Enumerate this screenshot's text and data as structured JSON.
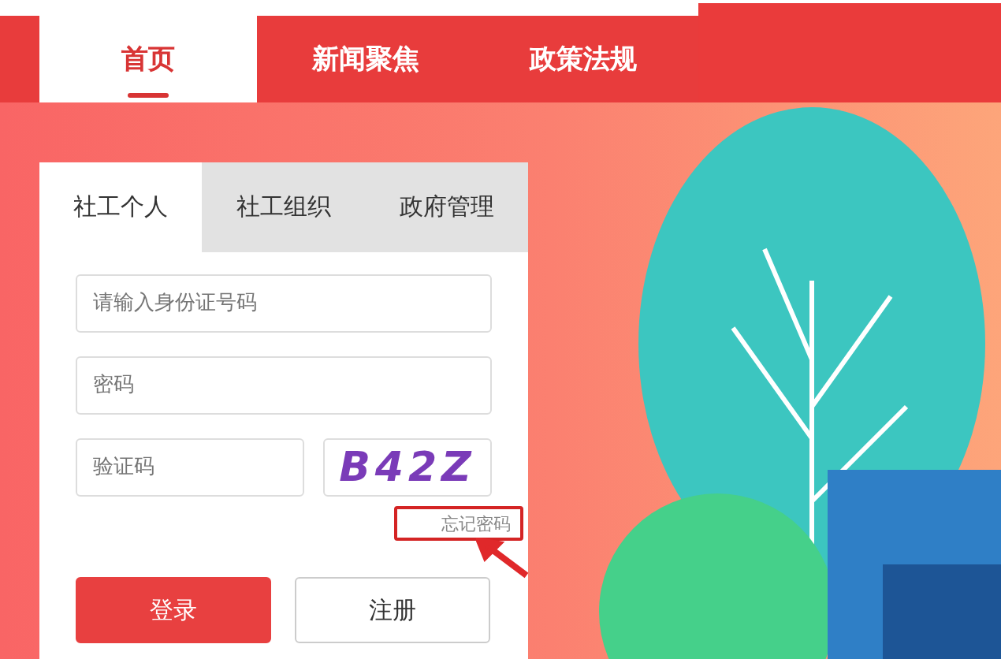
{
  "nav": {
    "items": [
      {
        "label": "首页",
        "selected": true
      },
      {
        "label": "新闻聚焦",
        "selected": false
      },
      {
        "label": "政策法规",
        "selected": false
      }
    ]
  },
  "login": {
    "tabs": [
      {
        "label": "社工个人",
        "selected": true
      },
      {
        "label": "社工组织",
        "selected": false
      },
      {
        "label": "政府管理",
        "selected": false
      }
    ],
    "id_field": {
      "placeholder": "请输入身份证号码"
    },
    "password_field": {
      "placeholder": "密码"
    },
    "captcha_field": {
      "placeholder": "验证码"
    },
    "captcha": "B42Z",
    "forgot_link": "忘记密码",
    "buttons": [
      {
        "label": "登录",
        "kind": "primary"
      },
      {
        "label": "注册",
        "kind": "secondary"
      }
    ]
  }
}
